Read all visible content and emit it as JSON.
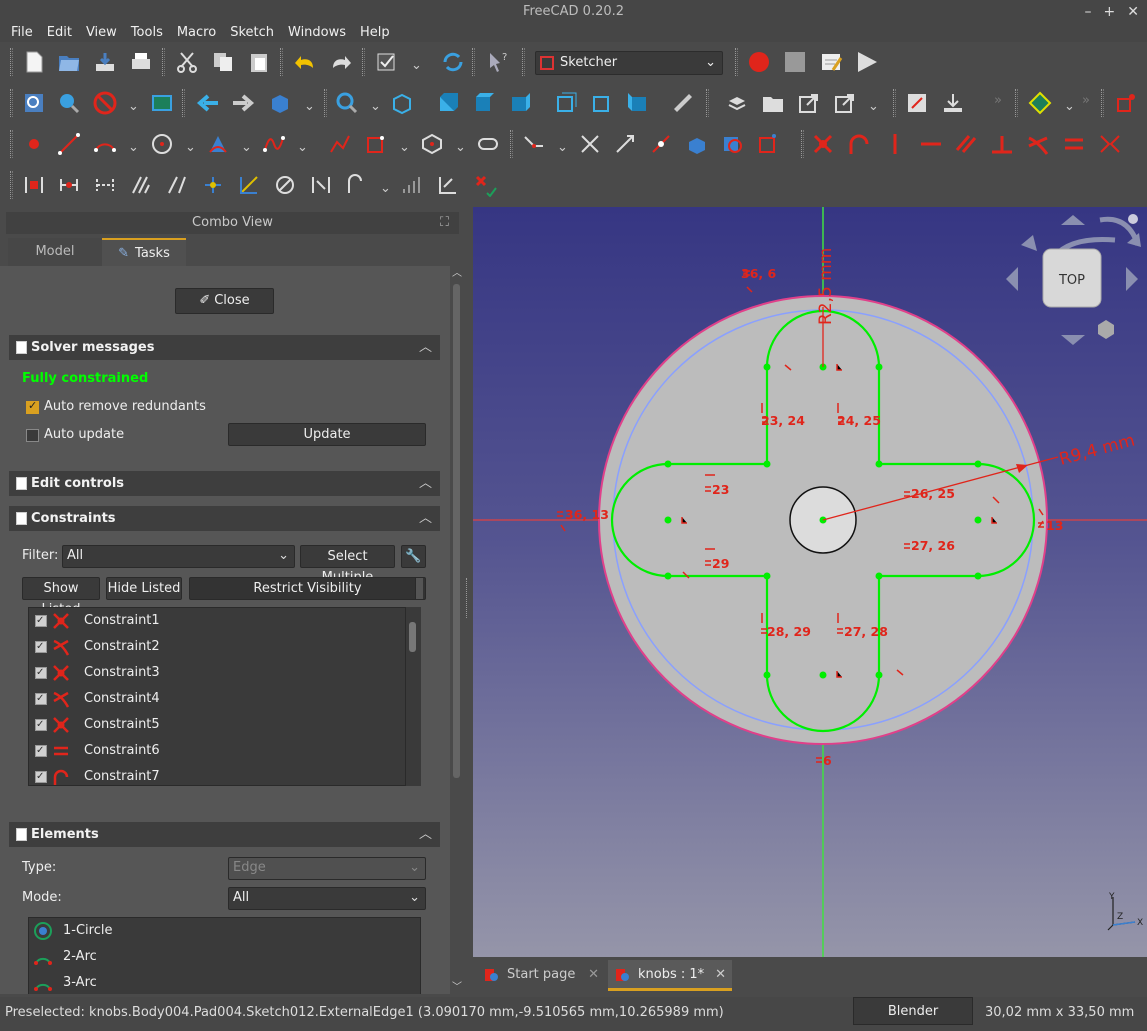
{
  "window": {
    "title": "FreeCAD 0.20.2",
    "controls": [
      "–",
      "+",
      "✕"
    ]
  },
  "menubar": [
    "File",
    "Edit",
    "View",
    "Tools",
    "Macro",
    "Sketch",
    "Windows",
    "Help"
  ],
  "toolbar": {
    "workbench": "Sketcher",
    "overflow": "»"
  },
  "combo_view": {
    "title": "Combo View",
    "tabs": [
      "Model",
      "Tasks"
    ],
    "close_button": "Close",
    "solver": {
      "title": "Solver messages",
      "status": "Fully constrained",
      "status_color": "#00ff00",
      "auto_remove_redundants": "Auto remove redundants",
      "auto_update": "Auto update",
      "update_button": "Update"
    },
    "edit_controls": {
      "title": "Edit controls"
    },
    "constraints": {
      "title": "Constraints",
      "filter_label": "Filter:",
      "filter_value": "All",
      "select_multiple": "Select Multiple",
      "show_listed": "Show Listed",
      "hide_listed": "Hide Listed",
      "restrict_visibility": "Restrict Visibility",
      "items": [
        {
          "label": "Constraint1",
          "icon": "coincident-icon"
        },
        {
          "label": "Constraint2",
          "icon": "tangent-icon"
        },
        {
          "label": "Constraint3",
          "icon": "coincident-icon"
        },
        {
          "label": "Constraint4",
          "icon": "tangent-icon"
        },
        {
          "label": "Constraint5",
          "icon": "coincident-icon"
        },
        {
          "label": "Constraint6",
          "icon": "equal-icon"
        },
        {
          "label": "Constraint7",
          "icon": "radius-icon"
        }
      ]
    },
    "elements": {
      "title": "Elements",
      "type_label": "Type:",
      "type_value": "Edge",
      "mode_label": "Mode:",
      "mode_value": "All",
      "items": [
        {
          "label": "1-Circle",
          "icon": "circle-icon"
        },
        {
          "label": "2-Arc",
          "icon": "arc-icon"
        },
        {
          "label": "3-Arc",
          "icon": "arc-icon"
        }
      ]
    }
  },
  "viewport": {
    "nav_cube_face": "TOP",
    "dimension_labels": {
      "radius_large": "R9,4 mm",
      "radius_small": "R2,5 mm"
    },
    "constraint_labels": [
      "36, 6",
      "23, 24",
      "24, 25",
      "23",
      "26, 25",
      "36, 13",
      "13",
      "29",
      "27, 26",
      "28, 29",
      "27, 28",
      "6"
    ],
    "axis_labels": {
      "x": "X",
      "y": "Y",
      "z": "Z"
    }
  },
  "view_tabs": [
    {
      "label": "Start page",
      "active": false
    },
    {
      "label": "knobs : 1*",
      "active": true
    }
  ],
  "statusbar": {
    "message": "Preselected: knobs.Body004.Pad004.Sketch012.ExternalEdge1 (3.090170 mm,-9.510565 mm,10.265989 mm)",
    "nav_style": "Blender",
    "dimensions": "30,02 mm x 33,50 mm"
  },
  "colors": {
    "accent": "#d9a020",
    "constraint_red": "#e0251b",
    "sketch_green": "#00ff00"
  }
}
